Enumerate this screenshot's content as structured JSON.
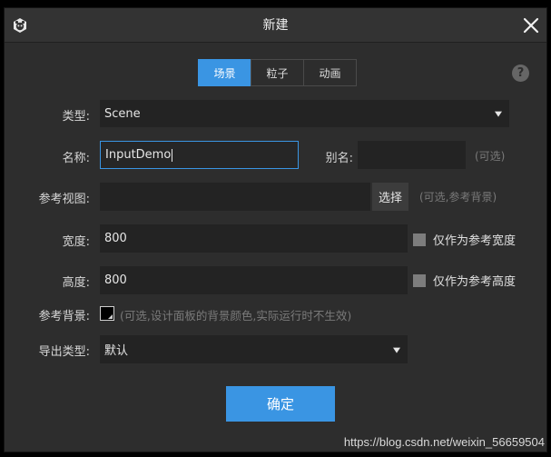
{
  "window": {
    "title": "新建"
  },
  "tabs": [
    {
      "label": "场景",
      "active": true
    },
    {
      "label": "粒子",
      "active": false
    },
    {
      "label": "动画",
      "active": false
    }
  ],
  "help": {
    "glyph": "?"
  },
  "form": {
    "type": {
      "label": "类型:",
      "value": "Scene"
    },
    "name": {
      "label": "名称:",
      "value": "InputDemo"
    },
    "alias": {
      "label": "别名:",
      "value": "",
      "hint": "(可选)"
    },
    "ref_view": {
      "label": "参考视图:",
      "value": "",
      "button": "选择",
      "hint": "(可选,参考背景)"
    },
    "width": {
      "label": "宽度:",
      "value": "800",
      "checkbox_label": "仅作为参考宽度"
    },
    "height": {
      "label": "高度:",
      "value": "800",
      "checkbox_label": "仅作为参考高度"
    },
    "ref_bg": {
      "label": "参考背景:",
      "hint": "(可选,设计面板的背景颜色,实际运行时不生效)",
      "color": "#000000"
    },
    "export_type": {
      "label": "导出类型:",
      "value": "默认"
    }
  },
  "confirm_label": "确定",
  "watermark": "https://blog.csdn.net/weixin_56659504",
  "colors": {
    "accent": "#3a95e3",
    "background": "#2d2d2d",
    "field": "#232323"
  }
}
